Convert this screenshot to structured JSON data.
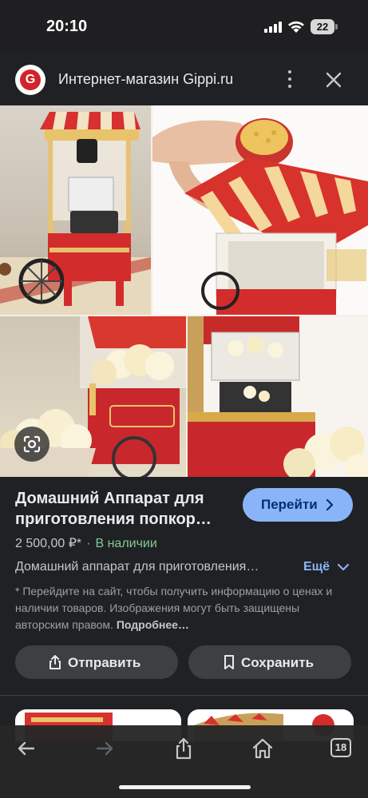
{
  "status_bar": {
    "time": "20:10",
    "battery": "22"
  },
  "site": {
    "logo_letter": "G",
    "title": "Интернет-магазин Gippi.ru"
  },
  "product": {
    "title": "Домашний Аппарат для приготовления попкор…",
    "visit_label": "Перейти",
    "price": "2 500,00 ₽*",
    "separator": "·",
    "availability": "В наличии",
    "description": "Домашний аппарат для приготовления…",
    "more_label": "Ещё",
    "disclaimer": "* Перейдите на сайт, чтобы получить информацию о ценах и наличии товаров. Изображения могут быть защищены авторским правом.",
    "disclaimer_link": "Подробнее…",
    "share_label": "Отправить",
    "save_label": "Сохранить"
  },
  "toolbar": {
    "tab_count": "18"
  },
  "colors": {
    "accent": "#8ab4f8",
    "in_stock": "#81c995",
    "brand_red": "#d2232a",
    "background": "#202124"
  },
  "icons": [
    "signal-icon",
    "wifi-icon",
    "battery-icon",
    "more-vert-icon",
    "close-icon",
    "lens-icon",
    "chevron-right-icon",
    "chevron-down-icon",
    "share-icon",
    "bookmark-icon",
    "back-arrow-icon",
    "forward-arrow-icon",
    "home-icon",
    "tabs-icon"
  ]
}
